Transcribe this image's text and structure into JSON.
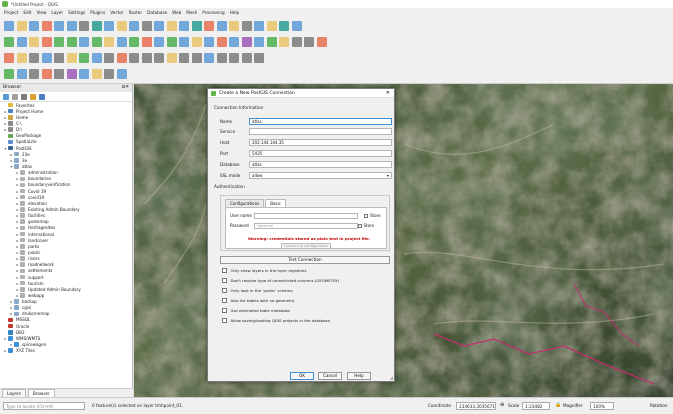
{
  "window": {
    "title": "*Untitled Project - QGIS"
  },
  "menubar": [
    "Project",
    "Edit",
    "View",
    "Layer",
    "Settings",
    "Plugins",
    "Vector",
    "Raster",
    "Database",
    "Web",
    "Mesh",
    "Processing",
    "Help"
  ],
  "browser": {
    "title": "Browser",
    "tree": [
      {
        "indent": 0,
        "arrow": "",
        "label": "Favorites",
        "icon": "#e2b93b"
      },
      {
        "indent": 0,
        "arrow": "▸",
        "label": "Project Home",
        "icon": "#4a7fc1"
      },
      {
        "indent": 0,
        "arrow": "▸",
        "label": "Home",
        "icon": "#c9a544"
      },
      {
        "indent": 0,
        "arrow": "▸",
        "label": "C:\\",
        "icon": "#888888"
      },
      {
        "indent": 0,
        "arrow": "▸",
        "label": "D:\\",
        "icon": "#888888"
      },
      {
        "indent": 0,
        "arrow": "",
        "label": "GeoPackage",
        "icon": "#6aa84f"
      },
      {
        "indent": 0,
        "arrow": "",
        "label": "SpatiaLite",
        "icon": "#5b8bd0"
      },
      {
        "indent": 0,
        "arrow": "▾",
        "label": "PostGIS",
        "icon": "#336791"
      },
      {
        "indent": 1,
        "arrow": "▸",
        "label": "23e",
        "icon": "#8aa8c8"
      },
      {
        "indent": 1,
        "arrow": "▸",
        "label": "3e",
        "icon": "#8aa8c8"
      },
      {
        "indent": 1,
        "arrow": "▾",
        "label": "atlas",
        "icon": "#8aa8c8"
      },
      {
        "indent": 2,
        "arrow": "▸",
        "label": "administration",
        "icon": "#b0b0b0"
      },
      {
        "indent": 2,
        "arrow": "▸",
        "label": "boundaries",
        "icon": "#b0b0b0"
      },
      {
        "indent": 2,
        "arrow": "▸",
        "label": "boundaryverification",
        "icon": "#b0b0b0"
      },
      {
        "indent": 2,
        "arrow": "▸",
        "label": "Covid 19",
        "icon": "#b0b0b0"
      },
      {
        "indent": 2,
        "arrow": "▸",
        "label": "covid19",
        "icon": "#b0b0b0"
      },
      {
        "indent": 2,
        "arrow": "▸",
        "label": "elevation",
        "icon": "#b0b0b0"
      },
      {
        "indent": 2,
        "arrow": "▸",
        "label": "Existing Admin Boundary",
        "icon": "#b0b0b0"
      },
      {
        "indent": 2,
        "arrow": "▸",
        "label": "facilities",
        "icon": "#b0b0b0"
      },
      {
        "indent": 2,
        "arrow": "▸",
        "label": "gustemap",
        "icon": "#b0b0b0"
      },
      {
        "indent": 2,
        "arrow": "▸",
        "label": "Heritagesites",
        "icon": "#b0b0b0"
      },
      {
        "indent": 2,
        "arrow": "▸",
        "label": "international",
        "icon": "#b0b0b0"
      },
      {
        "indent": 2,
        "arrow": "▸",
        "label": "landcover",
        "icon": "#b0b0b0"
      },
      {
        "indent": 2,
        "arrow": "▸",
        "label": "parks",
        "icon": "#b0b0b0"
      },
      {
        "indent": 2,
        "arrow": "▸",
        "label": "public",
        "icon": "#b0b0b0"
      },
      {
        "indent": 2,
        "arrow": "▸",
        "label": "rivers",
        "icon": "#b0b0b0"
      },
      {
        "indent": 2,
        "arrow": "▸",
        "label": "roadnetwork",
        "icon": "#b0b0b0"
      },
      {
        "indent": 2,
        "arrow": "▸",
        "label": "settlements",
        "icon": "#b0b0b0"
      },
      {
        "indent": 2,
        "arrow": "▸",
        "label": "support",
        "icon": "#b0b0b0"
      },
      {
        "indent": 2,
        "arrow": "▸",
        "label": "tourism",
        "icon": "#b0b0b0"
      },
      {
        "indent": 2,
        "arrow": "▸",
        "label": "Updated Admin Boundary",
        "icon": "#b0b0b0"
      },
      {
        "indent": 2,
        "arrow": "▸",
        "label": "webapp",
        "icon": "#b0b0b0"
      },
      {
        "indent": 1,
        "arrow": "▸",
        "label": "backup",
        "icon": "#8aa8c8"
      },
      {
        "indent": 1,
        "arrow": "▸",
        "label": "cgisi",
        "icon": "#8aa8c8"
      },
      {
        "indent": 1,
        "arrow": "▸",
        "label": "drukornemap",
        "icon": "#8aa8c8"
      },
      {
        "indent": 0,
        "arrow": "",
        "label": "MSSQL",
        "icon": "#c0392b"
      },
      {
        "indent": 0,
        "arrow": "",
        "label": "Oracle",
        "icon": "#c0392b"
      },
      {
        "indent": 0,
        "arrow": "",
        "label": "DB2",
        "icon": "#2e86c1"
      },
      {
        "indent": 0,
        "arrow": "▸",
        "label": "WMS/WMTS",
        "icon": "#3d8fd6"
      },
      {
        "indent": 1,
        "arrow": "▸",
        "label": "spicewagen",
        "icon": "#3d8fd6"
      },
      {
        "indent": 0,
        "arrow": "▸",
        "label": "XYZ Tiles",
        "icon": "#3d8fd6"
      }
    ],
    "tabs": [
      "Layers",
      "Browser"
    ]
  },
  "dialog": {
    "title": "Create a New PostGIS Connection",
    "connection_section": "Connection Information",
    "fields": {
      "name_label": "Name",
      "name_value": "atlas",
      "service_label": "Service",
      "service_value": "",
      "host_label": "Host",
      "host_value": "202.144.144.35",
      "port_label": "Port",
      "port_value": "5435",
      "database_label": "Database",
      "database_value": "atlas",
      "ssl_label": "SSL mode",
      "ssl_value": "allow"
    },
    "auth_section": "Authentication",
    "auth_tabs": [
      "Configurations",
      "Basic"
    ],
    "username_label": "User name",
    "username_value": "",
    "password_label": "Password",
    "password_placeholder": "Optional",
    "store_label": "Store",
    "warning": "Warning: credentials stored as plain text in project file.",
    "convert_button": "Convert to configuration",
    "test_button": "Test Connection",
    "options": [
      "Only show layers in the layer registries",
      "Don't resolve type of unrestricted columns (GEOMETRY)",
      "Only look in the 'public' schema",
      "Also list tables with no geometry",
      "Use estimated table metadata",
      "Allow saving/loading QGIS projects in the database"
    ],
    "ok_button": "OK",
    "cancel_button": "Cancel",
    "help_button": "Help"
  },
  "statusbar": {
    "locator_placeholder": "Type to locate (Ctrl+K)",
    "message": "0 feature(s) selected on layer tmhpoint_01.",
    "coordinate_label": "Coordinate",
    "coordinate": "234633,3035671",
    "scale_label": "Scale",
    "scale": "1:23482",
    "magnifier_label": "Magnifier",
    "magnifier": "100%",
    "rotation_label": "Rotation"
  }
}
